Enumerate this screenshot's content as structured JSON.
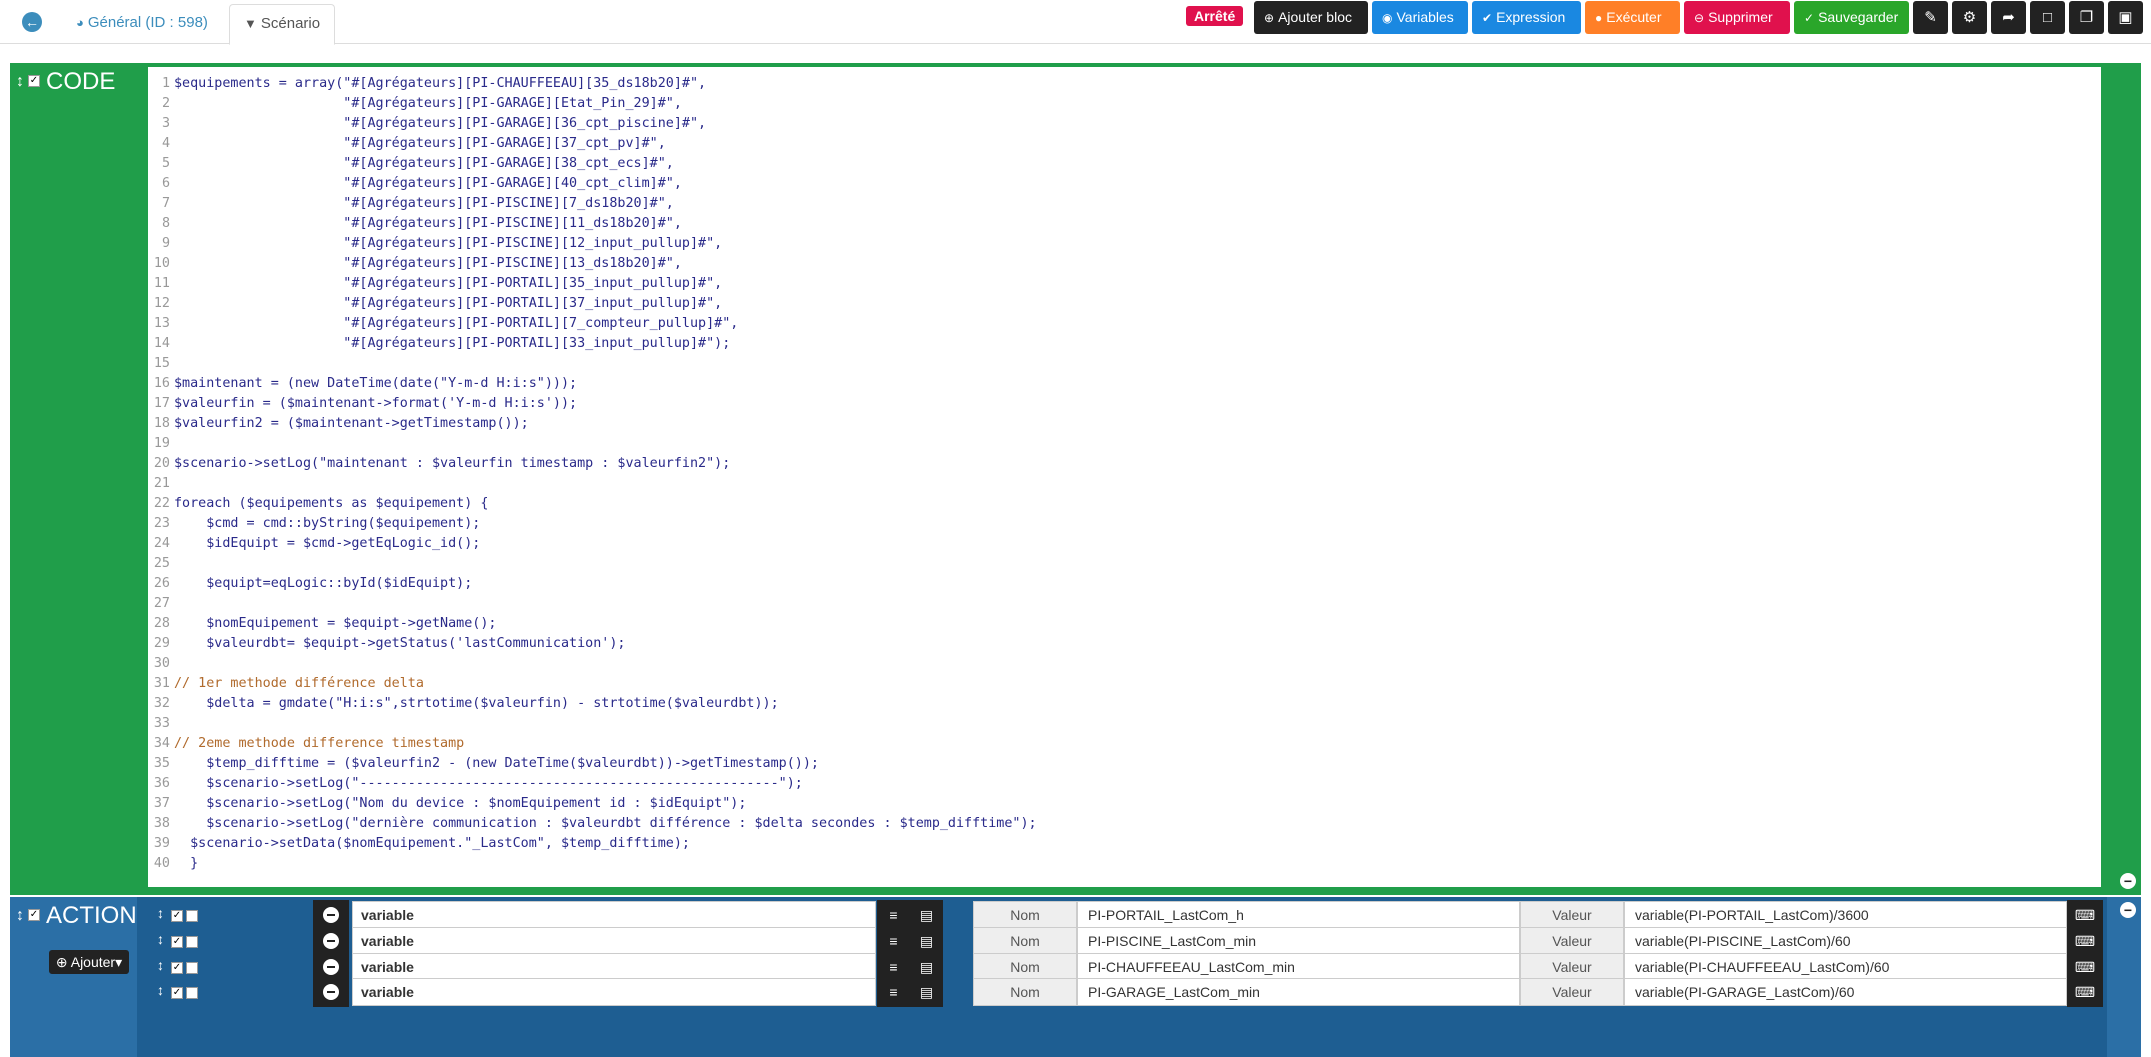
{
  "tabs": {
    "back_icon": "circle-arrow-left",
    "general_label": "Général (ID : 598)",
    "general_icon": "dashboard-icon",
    "scenario_label": "Scénario",
    "scenario_icon": "filter-icon"
  },
  "toolbar": {
    "status": "Arrêté",
    "add_block": "Ajouter bloc",
    "variables": "Variables",
    "expression": "Expression",
    "execute": "Exécuter",
    "delete": "Supprimer",
    "save": "Sauvegarder",
    "icon_buttons": [
      "edit-icon",
      "cogs-icon",
      "share-icon",
      "file-icon",
      "copy-icon",
      "expand-icon"
    ],
    "colors": {
      "status": "#e0114d",
      "dark": "#222222",
      "blue": "#1a88e1",
      "orange": "#ff7f27",
      "red": "#e0114d",
      "green": "#2aa62a"
    }
  },
  "code_block": {
    "title": "CODE",
    "color": "#209e4a",
    "lines": [
      "$equipements = array(\"#[Agrégateurs][PI-CHAUFFEEAU][35_ds18b20]#\",",
      "                     \"#[Agrégateurs][PI-GARAGE][Etat_Pin_29]#\",",
      "                     \"#[Agrégateurs][PI-GARAGE][36_cpt_piscine]#\",",
      "                     \"#[Agrégateurs][PI-GARAGE][37_cpt_pv]#\",",
      "                     \"#[Agrégateurs][PI-GARAGE][38_cpt_ecs]#\",",
      "                     \"#[Agrégateurs][PI-GARAGE][40_cpt_clim]#\",",
      "                     \"#[Agrégateurs][PI-PISCINE][7_ds18b20]#\",",
      "                     \"#[Agrégateurs][PI-PISCINE][11_ds18b20]#\",",
      "                     \"#[Agrégateurs][PI-PISCINE][12_input_pullup]#\",",
      "                     \"#[Agrégateurs][PI-PISCINE][13_ds18b20]#\",",
      "                     \"#[Agrégateurs][PI-PORTAIL][35_input_pullup]#\",",
      "                     \"#[Agrégateurs][PI-PORTAIL][37_input_pullup]#\",",
      "                     \"#[Agrégateurs][PI-PORTAIL][7_compteur_pullup]#\",",
      "                     \"#[Agrégateurs][PI-PORTAIL][33_input_pullup]#\");",
      "",
      "$maintenant = (new DateTime(date(\"Y-m-d H:i:s\")));",
      "$valeurfin = ($maintenant->format('Y-m-d H:i:s'));",
      "$valeurfin2 = ($maintenant->getTimestamp());",
      "",
      "$scenario->setLog(\"maintenant : $valeurfin timestamp : $valeurfin2\");",
      "",
      "foreach ($equipements as $equipement) {",
      "    $cmd = cmd::byString($equipement);",
      "    $idEquipt = $cmd->getEqLogic_id();",
      "",
      "    $equipt=eqLogic::byId($idEquipt);",
      "",
      "    $nomEquipement = $equipt->getName();",
      "    $valeurdbt= $equipt->getStatus('lastCommunication');",
      "",
      "// 1er methode différence delta",
      "    $delta = gmdate(\"H:i:s\",strtotime($valeurfin) - strtotime($valeurdbt));",
      "",
      "// 2eme methode difference timestamp",
      "    $temp_difftime = ($valeurfin2 - (new DateTime($valeurdbt))->getTimestamp());",
      "    $scenario->setLog(\"----------------------------------------------------\");",
      "    $scenario->setLog(\"Nom du device : $nomEquipement id : $idEquipt\");",
      "    $scenario->setLog(\"dernière communication : $valeurdbt différence : $delta secondes : $temp_difftime\");",
      "  $scenario->setData($nomEquipement.\"_LastCom\", $temp_difftime);",
      "  }"
    ]
  },
  "action_block": {
    "title": "ACTION",
    "color": "#2b6fa6",
    "add_label": "Ajouter",
    "rows": [
      {
        "command": "variable",
        "nom_label": "Nom",
        "nom": "PI-PORTAIL_LastCom_h",
        "valeur_label": "Valeur",
        "valeur": "variable(PI-PORTAIL_LastCom)/3600"
      },
      {
        "command": "variable",
        "nom_label": "Nom",
        "nom": "PI-PISCINE_LastCom_min",
        "valeur_label": "Valeur",
        "valeur": "variable(PI-PISCINE_LastCom)/60"
      },
      {
        "command": "variable",
        "nom_label": "Nom",
        "nom": "PI-CHAUFFEEAU_LastCom_min",
        "valeur_label": "Valeur",
        "valeur": "variable(PI-CHAUFFEEAU_LastCom)/60"
      },
      {
        "command": "variable",
        "nom_label": "Nom",
        "nom": "PI-GARAGE_LastCom_min",
        "valeur_label": "Valeur",
        "valeur": "variable(PI-GARAGE_LastCom)/60"
      }
    ]
  }
}
